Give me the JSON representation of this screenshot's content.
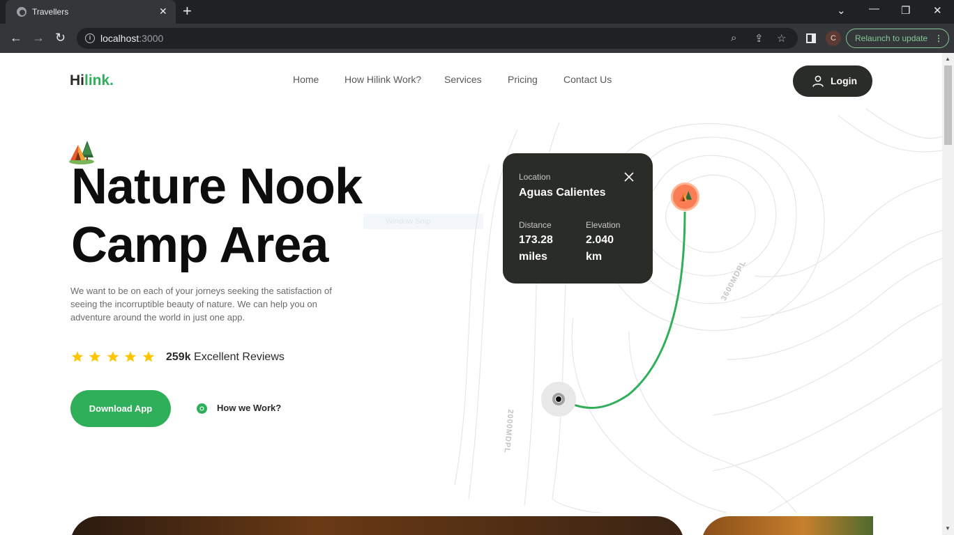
{
  "browser": {
    "tab_title": "Travellers",
    "url_host": "localhost",
    "url_port": ":3000",
    "profile_initial": "C",
    "relaunch_label": "Relaunch to update"
  },
  "site": {
    "logo_main": "Hi",
    "logo_accent": "link.",
    "nav": [
      "Home",
      "How Hilink Work?",
      "Services",
      "Pricing",
      "Contact Us"
    ],
    "login_label": "Login"
  },
  "hero": {
    "title_line1": "Nature Nook",
    "title_line2": "Camp Area",
    "description": "We want to be on each of your jorneys seeking the satisfaction of seeing the incorruptible beauty of nature. We can help you on adventure around the world in just one app.",
    "rating_stars": 5,
    "review_count": "259k",
    "review_label": "Excellent Reviews",
    "download_label": "Download App",
    "how_label": "How we Work?"
  },
  "location_card": {
    "location_label": "Location",
    "location_name": "Aguas Calientes",
    "distance_label": "Distance",
    "distance_value": "173.28 miles",
    "elevation_label": "Elevation",
    "elevation_value": "2.040 km"
  },
  "map": {
    "contour_label_1": "3600MDPL",
    "contour_label_2": "2000MDPL",
    "route_color": "#30af5b"
  },
  "overlay": {
    "snip_text": "Window Snip"
  },
  "colors": {
    "accent": "#30af5b",
    "dark": "#292c27",
    "star": "#fec601",
    "pin": "#f97d55"
  }
}
